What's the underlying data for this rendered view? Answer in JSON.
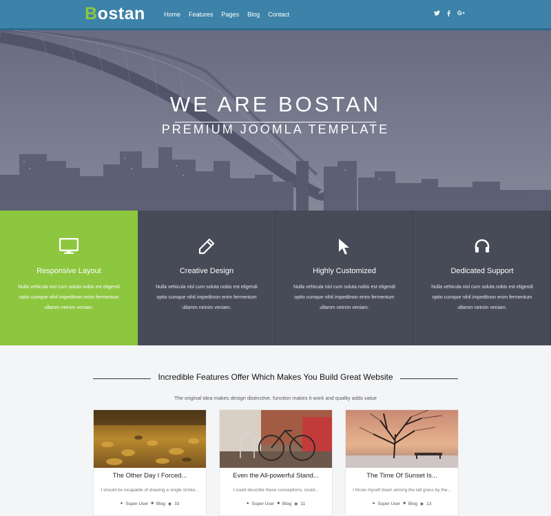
{
  "header": {
    "logo_first": "B",
    "logo_rest": "ostan",
    "nav": [
      "Home",
      "Features",
      "Pages",
      "Blog",
      "Contact"
    ],
    "social": [
      "twitter-icon",
      "facebook-icon",
      "google-plus-icon"
    ]
  },
  "hero": {
    "title": "WE ARE BOSTAN",
    "subtitle": "PREMIUM JOOMLA TEMPLATE"
  },
  "features": [
    {
      "icon": "monitor-icon",
      "title": "Responsive Layout",
      "desc": "Nulla vehicula nisl cum soluta nobis est eligendi optio cumque nihil impeditnon enim fermentum ullamm neinim veniam.",
      "accent": "#8dc63f"
    },
    {
      "icon": "pencil-icon",
      "title": "Creative Design",
      "desc": "Nulla vehicula nisl cum soluta nobis est eligendi optio cumque nihil impeditnon enim fermentum ullamm neinim veniam."
    },
    {
      "icon": "cursor-icon",
      "title": "Highly Customized",
      "desc": "Nulla vehicula nisl cum soluta nobis est eligendi optio cumque nihil impeditnon enim fermentum ullamm neinim veniam."
    },
    {
      "icon": "headphones-icon",
      "title": "Dedicated Support",
      "desc": "Nulla vehicula nisl cum soluta nobis est eligendi optio cumque nihil impeditnon enim fermentum ullamm neinim veniam."
    }
  ],
  "section": {
    "title": "Incredible Features Offer Which Makes You Build Great Website",
    "subtitle": "The original idea makes design distinctive, function makes it work and quality adds value"
  },
  "posts": [
    {
      "title": "The Other Day I Forced...",
      "excerpt": "I should be incapable of drawing a single stroke...",
      "author": "Super User",
      "category": "Blog",
      "views": "33"
    },
    {
      "title": "Even the All-powerful Stand...",
      "excerpt": "I could describe these conceptions, could...",
      "author": "Super User",
      "category": "Blog",
      "views": "11"
    },
    {
      "title": "The Time Of Sunset Is...",
      "excerpt": "I throw myself down among the tall grass by the...",
      "author": "Super User",
      "category": "Blog",
      "views": "13"
    }
  ],
  "colors": {
    "header": "#3d82a8",
    "accent": "#8dc63f",
    "feature_bg": "#474a57"
  }
}
